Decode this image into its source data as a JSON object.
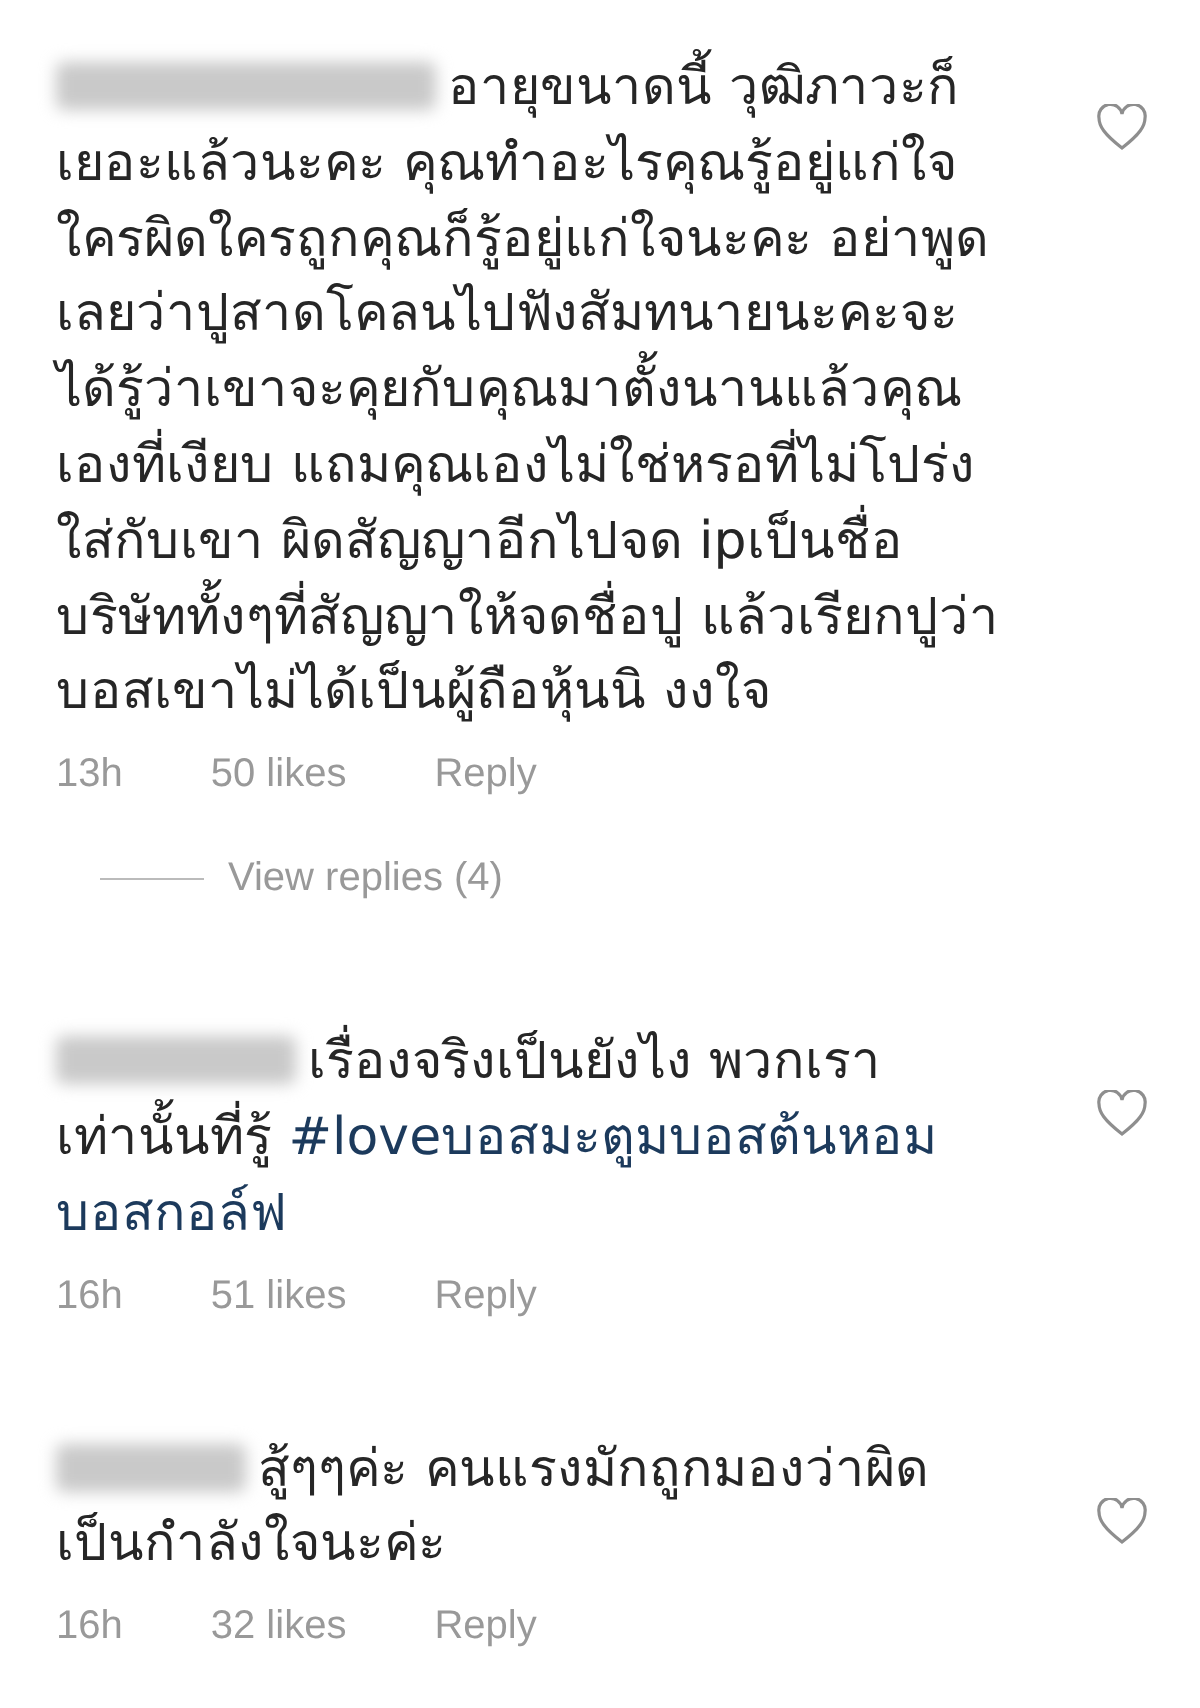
{
  "comments": [
    {
      "body": [
        {
          "kind": "text",
          "lines": [
            "อายุขนาดนี้ วุฒิภาวะก็",
            "เยอะแล้วนะคะ คุณทำอะไรคุณรู้อยู่แก่ใจ",
            "ใครผิดใครถูกคุณก็รู้อยู่แก่ใจนะคะ อย่าพูด",
            "เลยว่าปูสาดโคลนไปฟังสัมทนายนะคะจะ",
            "ได้รู้ว่าเขาจะคุยกับคุณมาตั้งนานแล้วคุณ",
            "เองที่เงียบ แถมคุณเองไม่ใช่หรอที่ไม่โปร่ง",
            "ใส่กับเขา ผิดสัญญาอีกไปจด ipเป็นชื่อ",
            "บริษัททั้งๆที่สัญญาให้จดชื่อปู แล้วเรียกปูว่า",
            "บอสเขาไม่ได้เป็นผู้ถือหุ้นนิ งงใจ"
          ]
        }
      ],
      "time": "13h",
      "likes": "50 likes",
      "reply": "Reply",
      "liked": false,
      "view_replies": "View replies (4)"
    },
    {
      "body": [
        {
          "kind": "text",
          "lines": [
            "เรื่องจริงเป็นยังไง พวกเรา",
            "เท่านั้นที่รู้ "
          ]
        },
        {
          "kind": "hashtag",
          "lines": [
            "#loveบอสมะตูมบอสต้นหอม",
            "บอสกอล์ฟ"
          ]
        }
      ],
      "time": "16h",
      "likes": "51 likes",
      "reply": "Reply",
      "liked": false
    },
    {
      "body": [
        {
          "kind": "text",
          "lines": [
            "สู้ๆๆค่ะ คนแรงมักถูกมองว่าผิด",
            "เป็นกำลังใจนะค่ะ"
          ]
        }
      ],
      "time": "16h",
      "likes": "32 likes",
      "reply": "Reply",
      "liked": false
    }
  ]
}
